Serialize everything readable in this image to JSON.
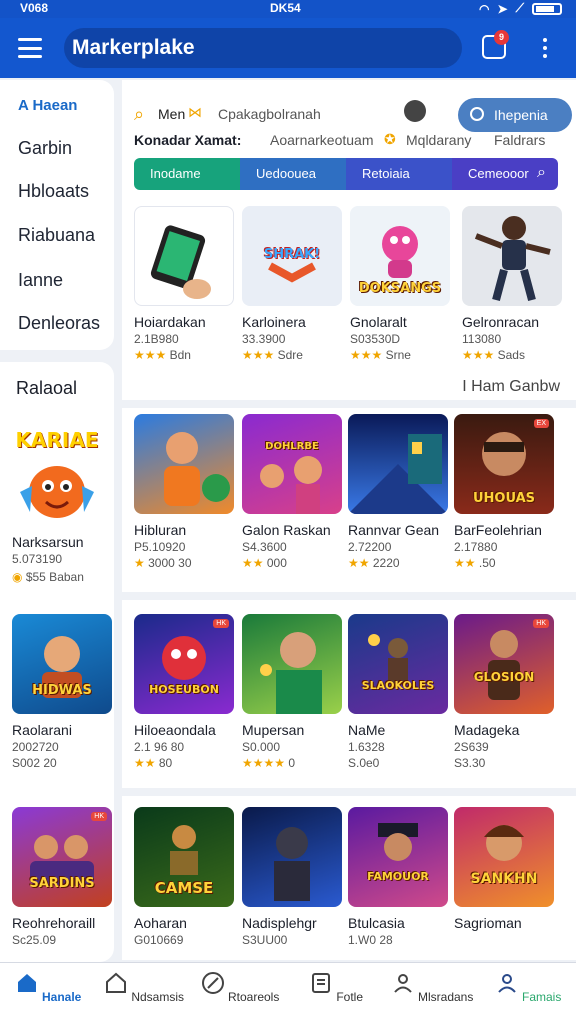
{
  "status": {
    "left": "V068",
    "center": "DK54"
  },
  "header": {
    "title": "Markerplake",
    "cart_count": "9"
  },
  "sidebar": {
    "items": [
      "A Haean",
      "Garbin",
      "Hbloaats",
      "Riabuana",
      "Ianne",
      "Denleoras"
    ],
    "featured": {
      "label": "Ralaoal",
      "badge": "KARIAE",
      "title": "Narksarsun",
      "price": "5.073190",
      "meta": "$55 Baban"
    }
  },
  "filters": {
    "search_hint": "Men",
    "search_text": "Cpakagbolranah",
    "search_button": "Ihepenia",
    "row2": [
      "Konadar Xamat:",
      "Aoarnarkeotuam",
      "Mqldarany",
      "Faldrars"
    ]
  },
  "tabs": [
    "Inodame",
    "Uedoouea",
    "Retoiaia",
    "Cemeooor"
  ],
  "section2_label": "I Ham Ganbw",
  "rows": [
    [
      {
        "title": "Hoiardakan",
        "price": "2.1B980",
        "stars": "★★★",
        "rating": "Bdn",
        "badge": ""
      },
      {
        "title": "Karloinera",
        "price": "33.3900",
        "stars": "★★★",
        "rating": "Sdre",
        "badge": "SHRAK!"
      },
      {
        "title": "Gnolaralt",
        "price": "S03530D",
        "stars": "★★★",
        "rating": "Srne",
        "badge": "DOKSANGS"
      },
      {
        "title": "Gelronracan",
        "price": "113080",
        "stars": "★★★",
        "rating": "Sads",
        "badge": ""
      }
    ],
    [
      {
        "title": "Hibluran",
        "price": "P5.10920",
        "stars": "★",
        "rating": "3000 30",
        "badge": ""
      },
      {
        "title": "Galon Raskan",
        "price": "S4.3600",
        "stars": "★★",
        "rating": "000",
        "badge": "DOHLRBE"
      },
      {
        "title": "Rannvar Gean",
        "price": "2.72200",
        "stars": "★★",
        "rating": "2220",
        "badge": ""
      },
      {
        "title": "BarFeolehrian",
        "price": "2.17880",
        "stars": "★★",
        "rating": ".50",
        "badge": "UHOUAS"
      }
    ],
    [
      {
        "title": "Hiloeaondala",
        "price": "2.1 96 80",
        "stars": "★★",
        "rating": "80",
        "badge": "HOSEUBON"
      },
      {
        "title": "Mupersan",
        "price": "S0.000",
        "stars": "★★★★",
        "rating": "0",
        "badge": ""
      },
      {
        "title": "NaMe",
        "price": "1.6328",
        "stars": "",
        "rating": "S.0e0",
        "badge": "SLAOKOLES"
      },
      {
        "title": "Madageka",
        "price": "2S639",
        "stars": "",
        "rating": "S3.30",
        "badge": "GLOSION"
      }
    ],
    [
      {
        "title": "Aoharan",
        "price": "G010669",
        "stars": "",
        "rating": "",
        "badge": "CAMSE"
      },
      {
        "title": "Nadisplehgr",
        "price": "S3UU00",
        "stars": "",
        "rating": "",
        "badge": ""
      },
      {
        "title": "Btulcasia",
        "price": "1.W0 28",
        "stars": "",
        "rating": "",
        "badge": "FAMOUOR"
      },
      {
        "title": "Sagrioman",
        "price": "",
        "stars": "",
        "rating": "",
        "badge": "SANKHN"
      }
    ]
  ],
  "side_cards": [
    {
      "title": "Raolarani",
      "price": "2002720",
      "meta": "S002 20",
      "badge": "HIDWAS"
    },
    {
      "title": "Reohrehoraill",
      "price": "Sc25.09",
      "meta": "",
      "badge": "SARDINS"
    }
  ],
  "bottom_nav": [
    "Hanale",
    "Ndsamsis",
    "Rtoareols",
    "Fotle",
    "Mlsradans",
    "Famais"
  ],
  "colors": {
    "primary": "#1357cf",
    "tab1": "#17a37c",
    "tab2": "#2f6fc2",
    "tab3": "#3b52c9",
    "tab4": "#4a3fc5",
    "active_nav": "#1a6ac8",
    "last_nav": "#2aa86d"
  }
}
